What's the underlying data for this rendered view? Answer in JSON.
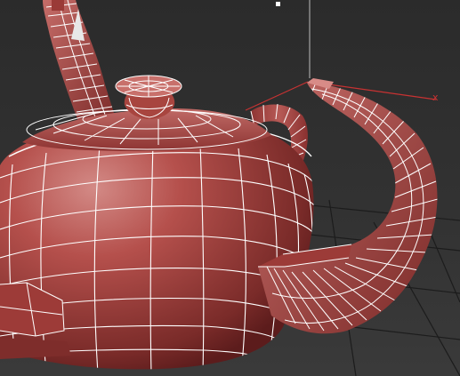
{
  "viewport": {
    "axes": {
      "x_label": "x",
      "x_color": "#c83232"
    },
    "object": {
      "name_icon": "teapot-model-icon",
      "surface_color": "#b5504c",
      "shadow_color": "#5c1c1c",
      "highlight_color": "#d38a86",
      "wireframe_color": "#ffffff"
    },
    "grid_color": "#1c1c1c",
    "pivot_color": "#ffffff"
  }
}
